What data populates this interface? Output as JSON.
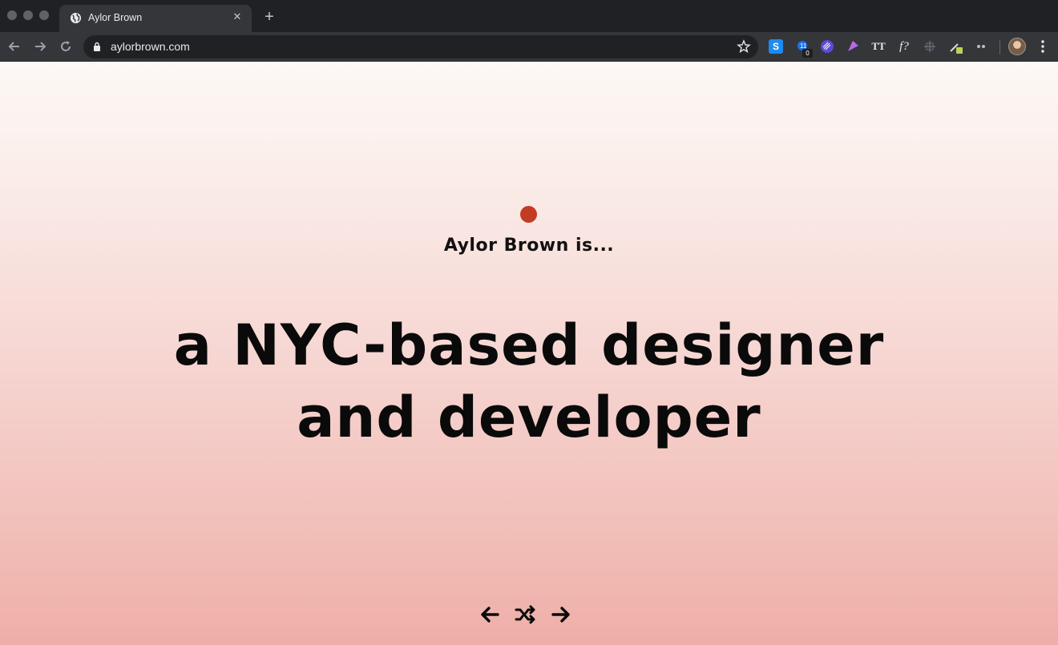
{
  "browser": {
    "tab": {
      "title": "Aylor Brown",
      "favicon": "globe-icon",
      "close_glyph": "✕"
    },
    "new_tab_glyph": "+",
    "url": "aylorbrown.com",
    "extensions": [
      {
        "name": "s-extension-icon",
        "label": "S"
      },
      {
        "name": "badge-extension-icon",
        "badge": "0"
      },
      {
        "name": "purple-circle-extension-icon"
      },
      {
        "name": "gradient-extension-icon"
      },
      {
        "name": "tt-extension-icon",
        "label": "TT"
      },
      {
        "name": "font-extension-icon",
        "label": "f?"
      },
      {
        "name": "crosshair-extension-icon"
      },
      {
        "name": "eyedropper-extension-icon"
      },
      {
        "name": "eyes-extension-icon"
      }
    ]
  },
  "page": {
    "kicker": "Aylor Brown is...",
    "headline_line1": "a NYC-based designer",
    "headline_line2": "and developer",
    "accent_color": "#c43b23",
    "controls": {
      "prev": "arrow-left-icon",
      "shuffle": "shuffle-icon",
      "next": "arrow-right-icon"
    }
  }
}
